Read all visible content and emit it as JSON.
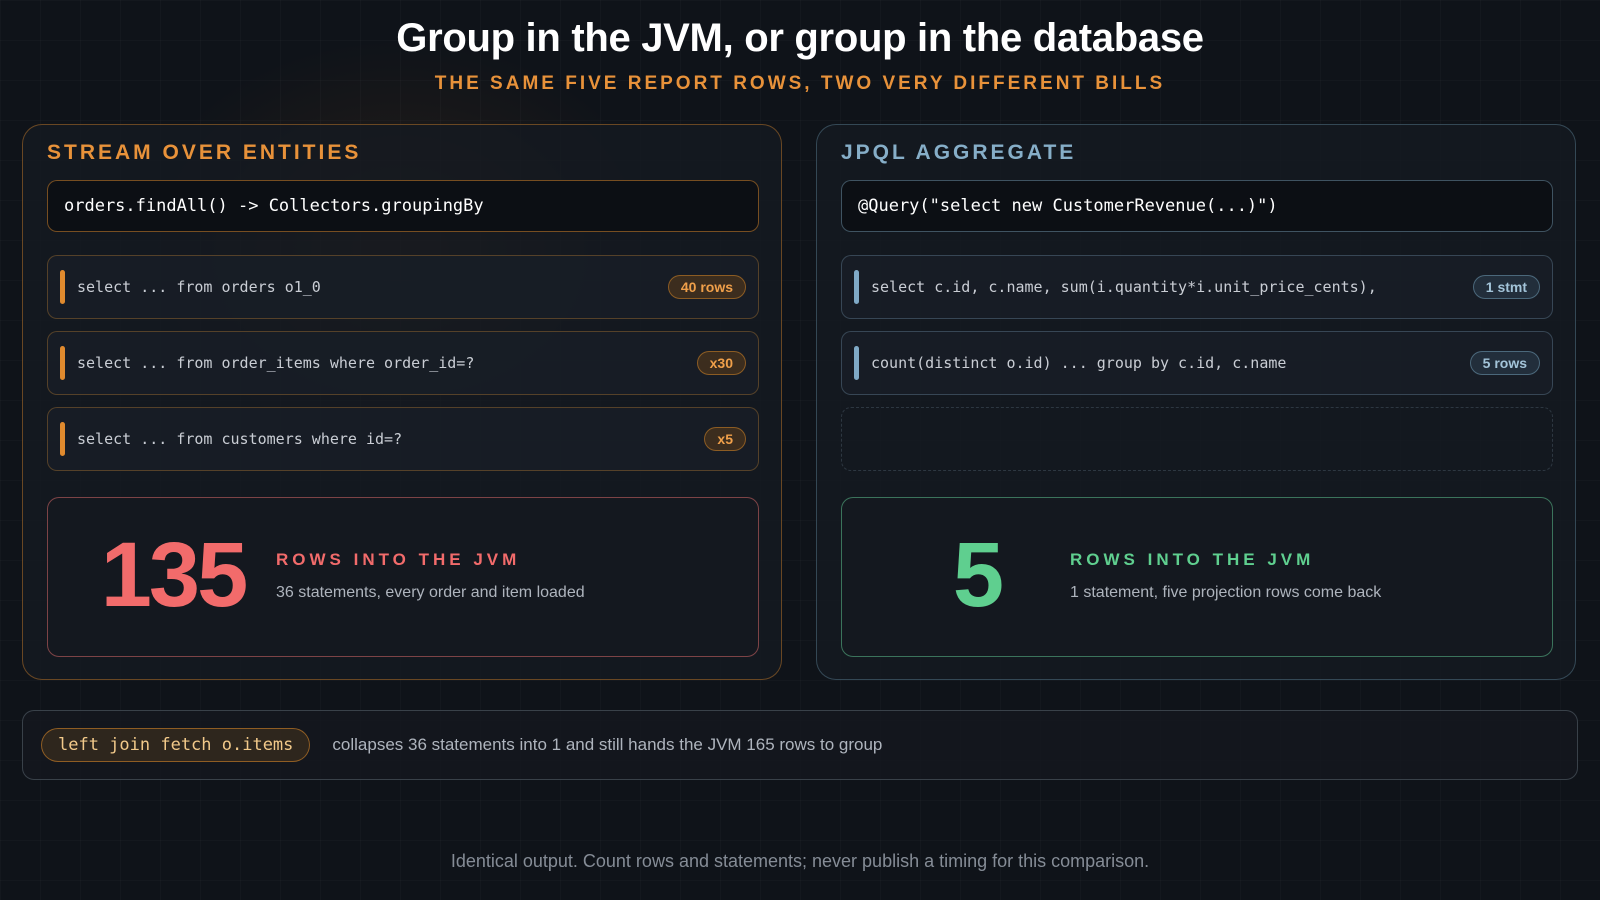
{
  "header": {
    "title": "Group in the JVM, or group in the database",
    "subtitle": "THE SAME FIVE REPORT ROWS, TWO VERY DIFFERENT BILLS"
  },
  "left_panel": {
    "heading": "STREAM OVER ENTITIES",
    "code": "orders.findAll() -> Collectors.groupingBy",
    "statements": [
      {
        "sql": "select ... from orders o1_0",
        "badge": "40 rows"
      },
      {
        "sql": "select ... from order_items where order_id=?",
        "badge": "x30"
      },
      {
        "sql": "select ... from customers where id=?",
        "badge": "x5"
      }
    ],
    "result": {
      "number": "135",
      "label": "ROWS INTO THE JVM",
      "description": "36 statements, every order and item loaded"
    }
  },
  "right_panel": {
    "heading": "JPQL AGGREGATE",
    "code": "@Query(\"select new CustomerRevenue(...)\")",
    "statements": [
      {
        "sql": "select c.id, c.name, sum(i.quantity*i.unit_price_cents),",
        "badge": "1 stmt"
      },
      {
        "sql": "count(distinct o.id) ... group by c.id, c.name",
        "badge": "5 rows"
      }
    ],
    "result": {
      "number": "5",
      "label": "ROWS INTO THE JVM",
      "description": "1 statement, five projection rows come back"
    }
  },
  "footnote": {
    "pill": "left join fetch o.items",
    "text": "collapses 36 statements into 1 and still hands the JVM 165 rows to group"
  },
  "caption": "Identical output. Count rows and statements; never publish a timing for this comparison.",
  "colors": {
    "background": "#0f1319",
    "accent_orange": "#e8923a",
    "accent_blue": "#86aec8",
    "result_red": "#f26b6b",
    "result_green": "#5fcf8f"
  }
}
